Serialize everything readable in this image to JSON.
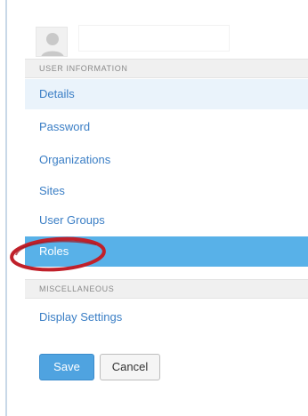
{
  "sections": {
    "user_information": "USER INFORMATION",
    "miscellaneous": "MISCELLANEOUS"
  },
  "nav": {
    "details": "Details",
    "password": "Password",
    "organizations": "Organizations",
    "sites": "Sites",
    "user_groups": "User Groups",
    "roles": "Roles",
    "display_settings": "Display Settings"
  },
  "active_item": "Roles",
  "actions": {
    "save_label": "Save",
    "cancel_label": "Cancel"
  },
  "colors": {
    "link": "#3a7ec5",
    "active_bg": "#58b1e8",
    "highlight_bg": "#eaf3fb",
    "save_bg": "#4fa3e0",
    "annotation": "#c0202a"
  },
  "icons": {
    "avatar": "user-silhouette-icon"
  }
}
